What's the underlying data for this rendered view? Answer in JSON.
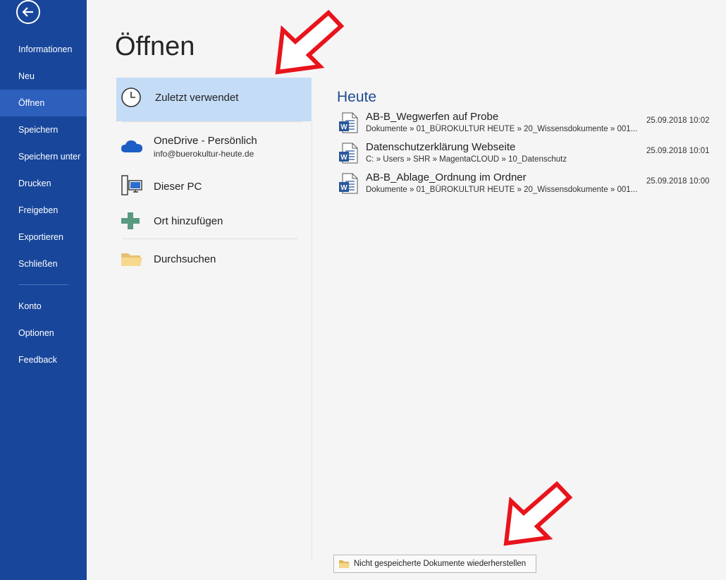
{
  "sidebar": {
    "items": [
      {
        "label": "Informationen"
      },
      {
        "label": "Neu"
      },
      {
        "label": "Öffnen"
      },
      {
        "label": "Speichern"
      },
      {
        "label": "Speichern unter"
      },
      {
        "label": "Drucken"
      },
      {
        "label": "Freigeben"
      },
      {
        "label": "Exportieren"
      },
      {
        "label": "Schließen"
      },
      {
        "label": "Konto"
      },
      {
        "label": "Optionen"
      },
      {
        "label": "Feedback"
      }
    ],
    "active": "Öffnen"
  },
  "page": {
    "title": "Öffnen"
  },
  "places": {
    "recent": "Zuletzt verwendet",
    "onedrive": {
      "label": "OneDrive - Persönlich",
      "account": "info@buerokultur-heute.de"
    },
    "pc": "Dieser PC",
    "add": "Ort hinzufügen",
    "browse": "Durchsuchen"
  },
  "recent": {
    "section": "Heute",
    "docs": [
      {
        "name": "AB-B_Wegwerfen auf Probe",
        "path": "Dokumente » 01_BÜROKULTUR HEUTE » 20_Wissensdokumente » 001...",
        "date": "25.09.2018 10:02"
      },
      {
        "name": "Datenschutzerklärung Webseite",
        "path": "C: » Users » SHR » MagentaCLOUD » 10_Datenschutz",
        "date": "25.09.2018 10:01"
      },
      {
        "name": "AB-B_Ablage_Ordnung im Ordner",
        "path": "Dokumente » 01_BÜROKULTUR HEUTE » 20_Wissensdokumente » 001...",
        "date": "25.09.2018 10:00"
      }
    ]
  },
  "recover_button": "Nicht gespeicherte Dokumente wiederherstellen",
  "colors": {
    "sidebar": "#18469b",
    "sidebar_active": "#2d5fbc",
    "selected_place": "#c5dcf6",
    "section_title": "#1d4b8f",
    "annotation_arrow": "#e8141c"
  }
}
